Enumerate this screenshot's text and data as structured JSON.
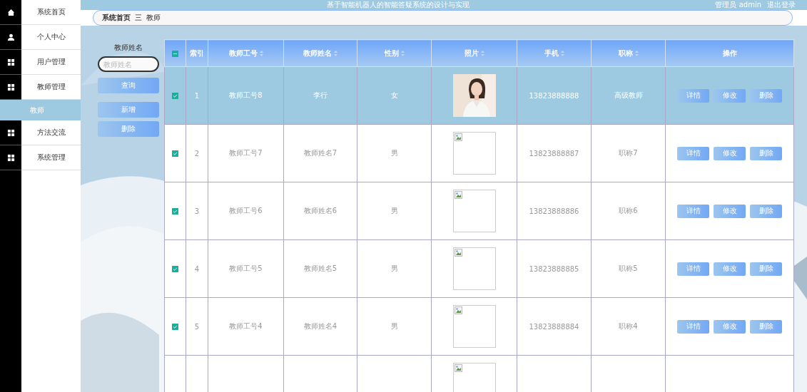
{
  "sidebar": {
    "items": [
      {
        "label": "系统首页",
        "kind": "home",
        "selected": false
      },
      {
        "label": "个人中心",
        "kind": "user",
        "selected": false
      },
      {
        "label": "用户管理",
        "kind": "grid",
        "selected": false
      },
      {
        "label": "教师管理",
        "kind": "grid",
        "selected": false,
        "children": [
          {
            "label": "教师",
            "selected": true
          }
        ]
      },
      {
        "label": "方法交流",
        "kind": "grid",
        "selected": false
      },
      {
        "label": "系统管理",
        "kind": "grid",
        "selected": false
      }
    ]
  },
  "header": {
    "title": "基于智能机器人的智能答疑系统的设计与实现",
    "user": "管理员 admin",
    "logout": "退出登录"
  },
  "breadcrumb": {
    "home": "系统首页",
    "separator": "三",
    "current": "教师"
  },
  "filter": {
    "label": "教师姓名",
    "placeholder": "教师姓名",
    "search_button": "查询",
    "add_button": "新增",
    "delete_button": "删除"
  },
  "table": {
    "header_checkbox": {
      "indeterminate": true
    },
    "columns": [
      {
        "label": "索引",
        "sortable": false
      },
      {
        "label": "教师工号",
        "sortable": true
      },
      {
        "label": "教师姓名",
        "sortable": true
      },
      {
        "label": "性别",
        "sortable": true
      },
      {
        "label": "照片",
        "sortable": true
      },
      {
        "label": "手机",
        "sortable": true
      },
      {
        "label": "职称",
        "sortable": true
      },
      {
        "label": "操作",
        "sortable": false
      }
    ],
    "rows": [
      {
        "checked": true,
        "selected": true,
        "index": "1",
        "teacher_id": "教师工号8",
        "name": "李行",
        "gender": "女",
        "phone": "13823888888",
        "title": "高级教师",
        "actions": [
          "详情",
          "修改",
          "删除"
        ]
      },
      {
        "checked": true,
        "selected": false,
        "index": "2",
        "teacher_id": "教师工号7",
        "name": "教师姓名7",
        "gender": "男",
        "photo": {
          "kind": "broken"
        },
        "phone": "13823888887",
        "title": "职称7",
        "actions": [
          "详情",
          "修改",
          "删除"
        ]
      },
      {
        "checked": true,
        "selected": false,
        "index": "3",
        "teacher_id": "教师工号6",
        "name": "教师姓名6",
        "gender": "男",
        "photo": {
          "kind": "broken"
        },
        "phone": "13823888886",
        "title": "职称6",
        "actions": [
          "详情",
          "修改",
          "删除"
        ]
      },
      {
        "checked": true,
        "selected": false,
        "index": "4",
        "teacher_id": "教师工号5",
        "name": "教师姓名5",
        "gender": "男",
        "photo": {
          "kind": "broken"
        },
        "phone": "13823888885",
        "title": "职称5",
        "actions": [
          "详情",
          "修改",
          "删除"
        ]
      },
      {
        "checked": true,
        "selected": false,
        "index": "5",
        "teacher_id": "教师工号4",
        "name": "教师姓名4",
        "gender": "男",
        "photo": {
          "kind": "broken"
        },
        "phone": "13823888884",
        "title": "职称4",
        "actions": [
          "详情",
          "修改",
          "删除"
        ]
      },
      {
        "selected": false,
        "photo": {
          "kind": "broken"
        }
      }
    ]
  }
}
